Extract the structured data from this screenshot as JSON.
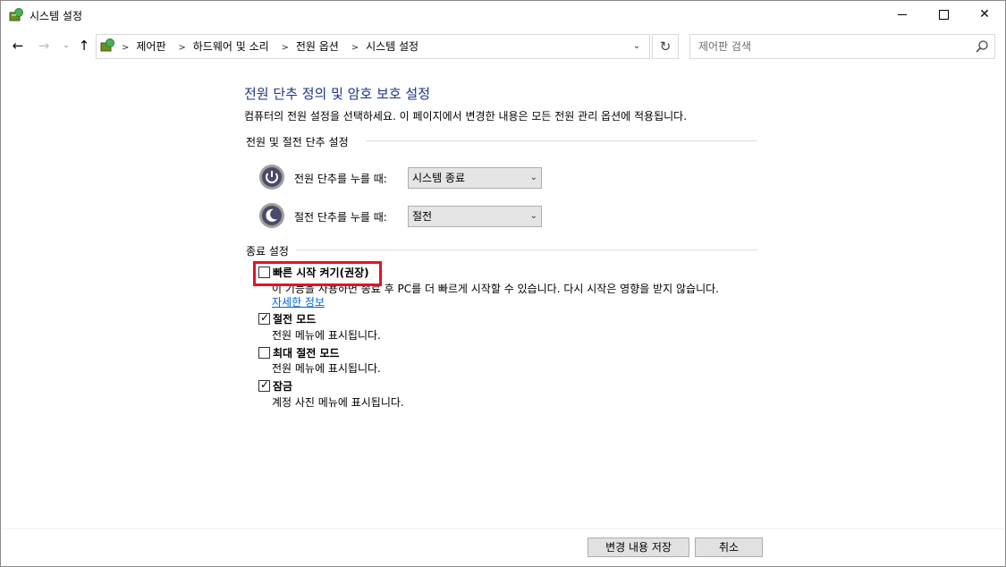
{
  "window": {
    "title": "시스템 설정"
  },
  "nav": {
    "back_icon": "arrow-left-icon",
    "forward_icon": "arrow-right-icon",
    "up_icon": "arrow-up-icon",
    "breadcrumbs": [
      "제어판",
      "하드웨어 및 소리",
      "전원 옵션",
      "시스템 설정"
    ],
    "search_placeholder": "제어판 검색"
  },
  "content": {
    "heading": "전원 단추 정의 및 암호 보호 설정",
    "description": "컴퓨터의 전원 설정을 선택하세요. 이 페이지에서 변경한 내용은 모든 전원 관리 옵션에 적용됩니다.",
    "power_group": {
      "label": "전원 및 절전 단추 설정",
      "power_button_label": "전원 단추를 누를 때:",
      "power_button_value": "시스템 종료",
      "sleep_button_label": "절전 단추를 누를 때:",
      "sleep_button_value": "절전"
    },
    "shutdown_group": {
      "label": "종료 설정",
      "options": [
        {
          "title": "빠른 시작 켜기(권장)",
          "desc": "이 기능을 사용하면 종료 후 PC를 더 빠르게 시작할 수 있습니다. 다시 시작은 영향을 받지 않습니다.",
          "checked": false
        },
        {
          "title": "절전 모드",
          "desc": "전원 메뉴에 표시됩니다.",
          "checked": true
        },
        {
          "title": "최대 절전 모드",
          "desc": "전원 메뉴에 표시됩니다.",
          "checked": false
        },
        {
          "title": "잠금",
          "desc": "계정 사진 메뉴에 표시됩니다.",
          "checked": true
        }
      ],
      "more_info_link": "자세한 정보"
    }
  },
  "footer": {
    "save_label": "변경 내용 저장",
    "cancel_label": "취소"
  },
  "colors": {
    "heading": "#1e3287",
    "link": "#0066cc",
    "highlight": "#e81123"
  }
}
